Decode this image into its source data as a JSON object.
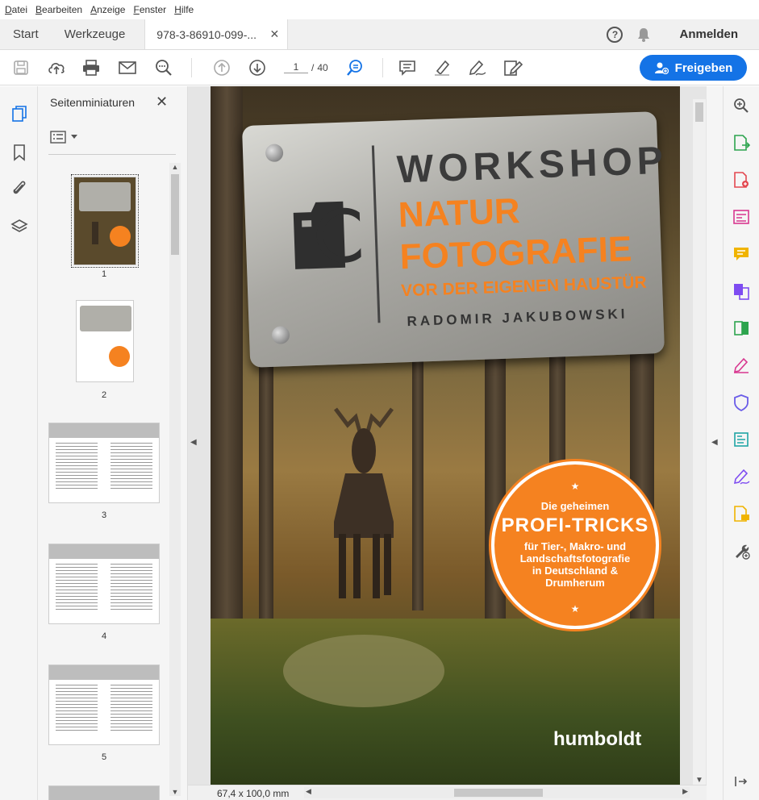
{
  "menu": [
    "Datei",
    "Bearbeiten",
    "Anzeige",
    "Fenster",
    "Hilfe"
  ],
  "tabs": {
    "start": "Start",
    "tools": "Werkzeuge",
    "doc": "978-3-86910-099-...",
    "close": "✕"
  },
  "header": {
    "help": "?",
    "signin": "Anmelden"
  },
  "toolbar": {
    "page_current": "1",
    "page_sep": "/",
    "page_total": "40",
    "share_label": "Freigeben"
  },
  "thumbpanel": {
    "title": "Seitenminiaturen",
    "close": "✕",
    "pages": [
      "1",
      "2",
      "3",
      "4",
      "5"
    ]
  },
  "cover": {
    "line1": "WORKSHOP",
    "line2": "NATUR",
    "line3": "FOTOGRAFIE",
    "line4": "VOR DER EIGENEN HAUSTÜR",
    "author": "RADOMIR JAKUBOWSKI",
    "badge_top": "Die geheimen",
    "badge_main": "PROFI-TRICKS",
    "badge_text": "für Tier-, Makro- und Landschaftsfotografie in Deutschland & Drumherum",
    "publisher": "humboldt"
  },
  "status": {
    "dimensions": "67,4 x 100,0 mm"
  },
  "colors": {
    "accent": "#1473e6",
    "orange": "#f58220"
  }
}
